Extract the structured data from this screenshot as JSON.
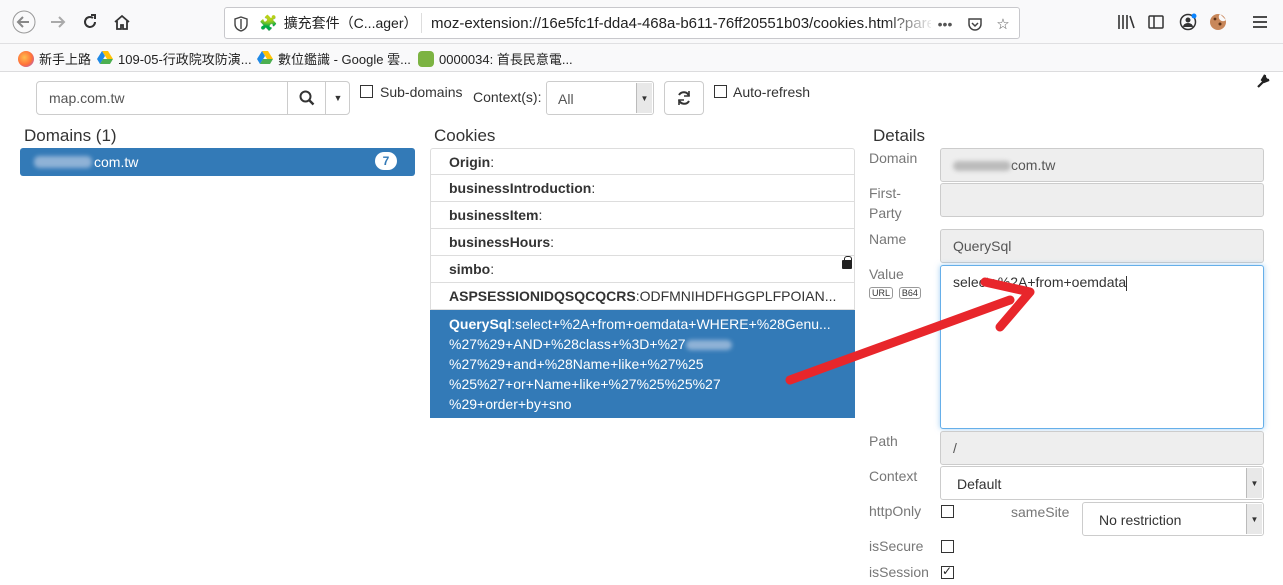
{
  "browser": {
    "extension_label": "擴充套件（C...ager）",
    "url": "moz-extension://16e5fc1f-dda4-468a-b611-76ff20551b03/cookies.html?parent=",
    "bookmarks": [
      {
        "label": "新手上路"
      },
      {
        "label": "109-05-行政院攻防演..."
      },
      {
        "label": "數位鑑識 - Google 雲..."
      },
      {
        "label": "0000034: 首長民意電..."
      }
    ]
  },
  "filter": {
    "search_value": "map.com.tw",
    "subdomains_label": "Sub-domains",
    "context_label": "Context(s):",
    "context_value": "All",
    "autorefresh_label": "Auto-refresh"
  },
  "domains": {
    "title": "Domains (1)",
    "item_suffix": "com.tw",
    "count": "7"
  },
  "cookies": {
    "title": "Cookies",
    "items": [
      {
        "name": "Origin",
        "value": ""
      },
      {
        "name": "businessIntroduction",
        "value": ""
      },
      {
        "name": "businessItem",
        "value": ""
      },
      {
        "name": "businessHours",
        "value": ""
      },
      {
        "name": "simbo",
        "value": ""
      },
      {
        "name": "ASPSESSIONIDQSQCQCRS",
        "value": "ODFMNIHDFHGGPLFPOIAN..."
      }
    ],
    "active": {
      "name": "QuerySql",
      "lines": [
        "select+%2A+from+oemdata+WHERE+%28Genu...",
        "%27%29+AND+%28class+%3D+%27",
        "%27%29+and+%28Name+like+%27%25",
        "%25%27+or+Name+like+%27%25%25%27",
        "%29+order+by+sno"
      ]
    }
  },
  "details": {
    "title": "Details",
    "domain_label": "Domain",
    "domain_suffix": "com.tw",
    "first_party_label_1": "First-",
    "first_party_label_2": "Party",
    "name_label": "Name",
    "name_value": "QuerySql",
    "value_label": "Value",
    "url_btn": "URL",
    "b64_btn": "B64",
    "value_text": "select+%2A+from+oemdata",
    "path_label": "Path",
    "path_value": "/",
    "context_label": "Context",
    "context_value": "Default",
    "httponly_label": "httpOnly",
    "samesite_label": "sameSite",
    "samesite_value": "No restriction",
    "issecure_label": "isSecure",
    "issession_label": "isSession"
  },
  "colors": {
    "accent": "#337ab7",
    "annotation_arrow": "#e8262b"
  }
}
